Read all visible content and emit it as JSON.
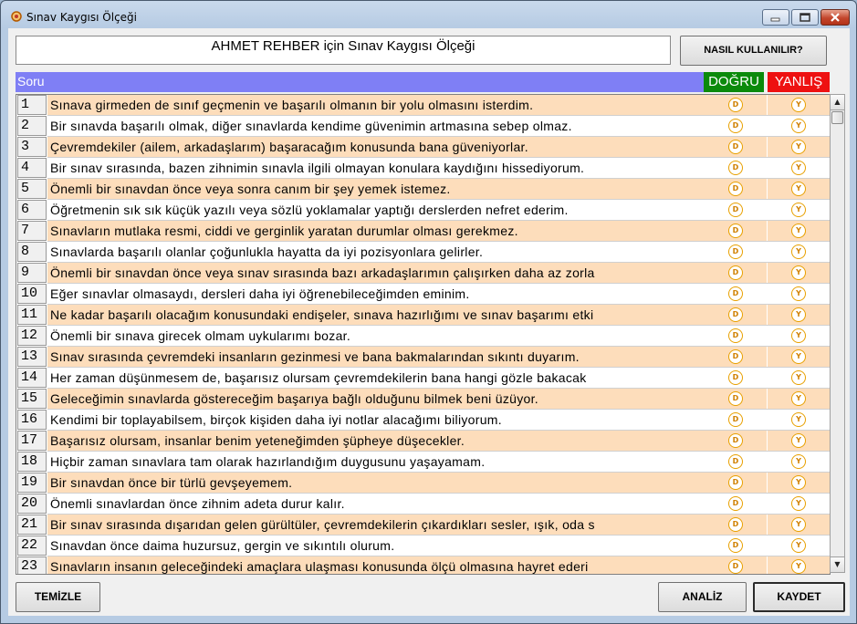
{
  "window": {
    "title": "Sınav Kaygısı Ölçeği"
  },
  "header": {
    "title_box": "AHMET REHBER için Sınav Kaygısı Ölçeği",
    "help_button": "NASIL KULLANILIR?"
  },
  "columns": {
    "question": "Soru",
    "true": "DOĞRU",
    "false": "YANLIŞ",
    "true_color": "#0b8a0b",
    "false_color": "#ee1111",
    "question_color": "#7f7ff5"
  },
  "radio_labels": {
    "true": "D",
    "false": "Y"
  },
  "row_highlight_color": "#fdddbb",
  "questions": [
    {
      "num": "1",
      "text": "Sınava girmeden de sınıf geçmenin ve başarılı olmanın  bir yolu olmasını isterdim."
    },
    {
      "num": "2",
      "text": "Bir sınavda başarılı olmak, diğer sınavlarda kendime güvenimin artmasına sebep olmaz."
    },
    {
      "num": "3",
      "text": "Çevremdekiler (ailem, arkadaşlarım) başaracağım konusunda bana güveniyorlar."
    },
    {
      "num": "4",
      "text": "Bir sınav sırasında, bazen zihnimin sınavla ilgili olmayan konulara kaydığını hissediyorum."
    },
    {
      "num": "5",
      "text": "Önemli bir sınavdan önce veya sonra canım bir şey yemek istemez."
    },
    {
      "num": "6",
      "text": "Öğretmenin sık sık küçük yazılı veya sözlü yoklamalar yaptığı derslerden nefret ederim."
    },
    {
      "num": "7",
      "text": "Sınavların mutlaka resmi, ciddi ve gerginlik yaratan durumlar olması gerekmez."
    },
    {
      "num": "8",
      "text": "Sınavlarda başarılı olanlar çoğunlukla hayatta da iyi pozisyonlara gelirler."
    },
    {
      "num": "9",
      "text": "Önemli bir sınavdan önce veya sınav sırasında bazı arkadaşlarımın çalışırken daha az zorla"
    },
    {
      "num": "10",
      "text": "Eğer sınavlar olmasaydı, dersleri daha iyi öğrenebileceğimden eminim."
    },
    {
      "num": "11",
      "text": "Ne kadar başarılı olacağım konusundaki endişeler, sınava hazırlığımı ve sınav başarımı etki"
    },
    {
      "num": "12",
      "text": "Önemli bir sınava girecek olmam uykularımı bozar."
    },
    {
      "num": "13",
      "text": "Sınav sırasında çevremdeki insanların gezinmesi ve bana bakmalarından sıkıntı duyarım."
    },
    {
      "num": "14",
      "text": "Her zaman düşünmesem de, başarısız olursam çevremdekilerin bana hangi gözle bakacak"
    },
    {
      "num": "15",
      "text": "Geleceğimin sınavlarda göstereceğim başarıya bağlı olduğunu bilmek beni üzüyor."
    },
    {
      "num": "16",
      "text": "Kendimi bir toplayabilsem, birçok kişiden daha iyi notlar alacağımı biliyorum."
    },
    {
      "num": "17",
      "text": "Başarısız olursam, insanlar benim yeteneğimden şüpheye düşecekler."
    },
    {
      "num": "18",
      "text": "Hiçbir zaman sınavlara tam olarak hazırlandığım duygusunu yaşayamam."
    },
    {
      "num": "19",
      "text": "Bir sınavdan önce bir türlü gevşeyemem."
    },
    {
      "num": "20",
      "text": "Önemli sınavlardan önce zihnim adeta durur kalır."
    },
    {
      "num": "21",
      "text": "Bir sınav sırasında dışarıdan gelen gürültüler, çevremdekilerin çıkardıkları sesler, ışık, oda s"
    },
    {
      "num": "22",
      "text": "Sınavdan önce daima huzursuz, gergin ve sıkıntılı olurum."
    },
    {
      "num": "23",
      "text": "Sınavların insanın geleceğindeki amaçlara ulaşması konusunda ölçü olmasına hayret ederi"
    }
  ],
  "footer": {
    "clear_button": "TEMİZLE",
    "analyze_button": "ANALİZ",
    "save_button": "KAYDET"
  }
}
